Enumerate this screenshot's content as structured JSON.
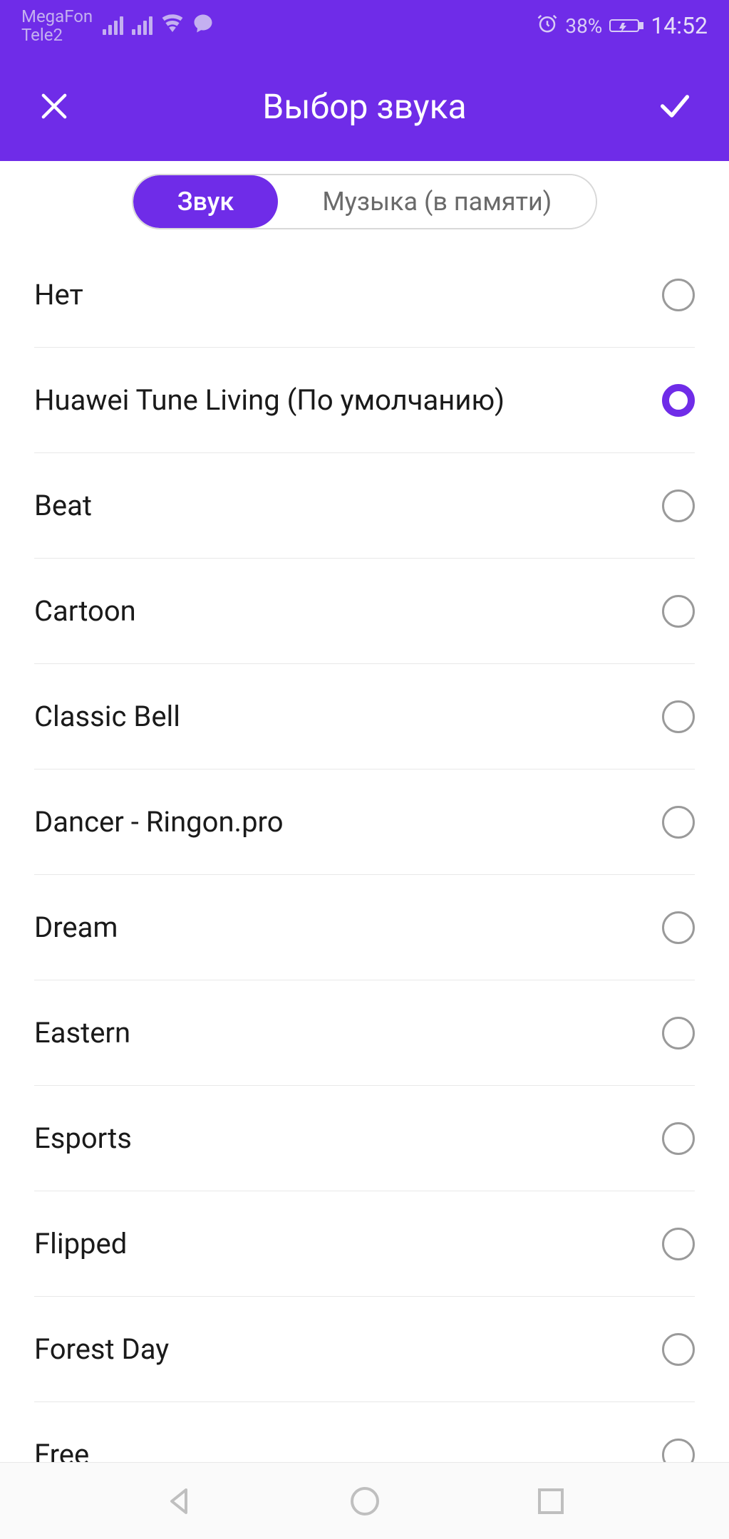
{
  "status_bar": {
    "carrier1": "MegaFon",
    "carrier2": "Tele2",
    "battery_pct": "38%",
    "time": "14:52"
  },
  "header": {
    "title": "Выбор звука"
  },
  "tabs": {
    "sound": "Звук",
    "music": "Музыка (в памяти)"
  },
  "sounds": [
    {
      "label": "Нет",
      "selected": false
    },
    {
      "label": "Huawei Tune Living (По умолчанию)",
      "selected": true
    },
    {
      "label": "Beat",
      "selected": false
    },
    {
      "label": "Cartoon",
      "selected": false
    },
    {
      "label": "Classic Bell",
      "selected": false
    },
    {
      "label": "Dancer - Ringon.pro",
      "selected": false
    },
    {
      "label": "Dream",
      "selected": false
    },
    {
      "label": "Eastern",
      "selected": false
    },
    {
      "label": "Esports",
      "selected": false
    },
    {
      "label": "Flipped",
      "selected": false
    },
    {
      "label": "Forest Day",
      "selected": false
    },
    {
      "label": "Free",
      "selected": false
    }
  ]
}
